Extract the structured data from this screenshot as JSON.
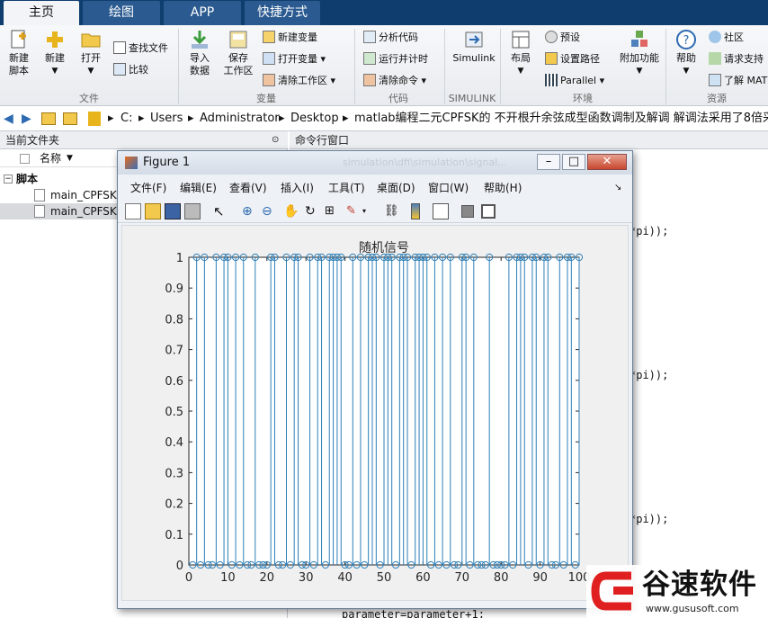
{
  "tabs": [
    "主页",
    "绘图",
    "APP",
    "快捷方式"
  ],
  "ribbon": {
    "buttons": {
      "new_script": "新建\n脚本",
      "new": "新建",
      "open": "打开",
      "find_files": "查找文件",
      "compare": "比较",
      "import_data": "导入\n数据",
      "save_workspace": "保存\n工作区",
      "new_variable": "新建变量",
      "open_variable": "打开变量",
      "clear_workspace": "清除工作区",
      "analyze_code": "分析代码",
      "run_time": "运行并计时",
      "clear_commands": "清除命令",
      "simulink": "Simulink",
      "layout": "布局",
      "preferences": "预设",
      "set_path": "设置路径",
      "parallel": "Parallel",
      "addons": "附加功能",
      "help": "帮助",
      "community": "社区",
      "request_support": "请求支持",
      "learn_matlab": "了解 MAT"
    },
    "sections": {
      "file": "文件",
      "variable": "变量",
      "code": "代码",
      "simulink": "SIMULINK",
      "environment": "环境",
      "resources": "资源"
    }
  },
  "address": [
    "C:",
    "Users",
    "Administrator",
    "Desktop",
    "matlab编程二元CPFSK的 不开根升余弦成型函数调制及解调 解调法采用了8倍采样的最"
  ],
  "left_panel": {
    "header": "当前文件夹",
    "col_name": "名称",
    "group": "脚本",
    "files": [
      "main_CPFSKM",
      "main_CPFSK2"
    ]
  },
  "command_window": {
    "header": "命令行窗口",
    "lines": [
      "*pi));",
      "*pi));",
      "*pi));",
      "parameter=parameter+1;"
    ]
  },
  "figure": {
    "title": "Figure 1",
    "faded_title": "simulation\\dfi\\simulation\\signal...",
    "menu": [
      "文件(F)",
      "编辑(E)",
      "查看(V)",
      "插入(I)",
      "工具(T)",
      "桌面(D)",
      "窗口(W)",
      "帮助(H)"
    ],
    "controls": [
      "minimize-icon",
      "maximize-icon",
      "close-icon"
    ]
  },
  "watermark": {
    "brand": "谷速软件",
    "url": "www.gususoft.com"
  },
  "chart_data": {
    "type": "stem",
    "title": "随机信号",
    "xlabel": "",
    "ylabel": "",
    "xlim": [
      0,
      100
    ],
    "ylim": [
      0,
      1
    ],
    "xticks": [
      0,
      10,
      20,
      30,
      40,
      50,
      60,
      70,
      80,
      90,
      100
    ],
    "yticks": [
      0,
      0.1,
      0.2,
      0.3,
      0.4,
      0.5,
      0.6,
      0.7,
      0.8,
      0.9,
      1
    ],
    "x": [
      1,
      2,
      3,
      4,
      5,
      6,
      7,
      8,
      9,
      10,
      11,
      12,
      13,
      14,
      15,
      16,
      17,
      18,
      19,
      20,
      21,
      22,
      23,
      24,
      25,
      26,
      27,
      28,
      29,
      30,
      31,
      32,
      33,
      34,
      35,
      36,
      37,
      38,
      39,
      40,
      41,
      42,
      43,
      44,
      45,
      46,
      47,
      48,
      49,
      50,
      51,
      52,
      53,
      54,
      55,
      56,
      57,
      58,
      59,
      60,
      61,
      62,
      63,
      64,
      65,
      66,
      67,
      68,
      69,
      70,
      71,
      72,
      73,
      74,
      75,
      76,
      77,
      78,
      79,
      80,
      81,
      82,
      83,
      84,
      85,
      86,
      87,
      88,
      89,
      90,
      91,
      92,
      93,
      94,
      95,
      96,
      97,
      98,
      99,
      100
    ],
    "y": [
      0,
      1,
      0,
      1,
      0,
      0,
      1,
      0,
      1,
      1,
      0,
      1,
      0,
      1,
      0,
      0,
      1,
      0,
      0,
      0,
      1,
      1,
      0,
      0,
      1,
      0,
      1,
      1,
      0,
      0,
      1,
      0,
      1,
      1,
      0,
      1,
      1,
      1,
      1,
      0,
      0,
      1,
      0,
      1,
      0,
      1,
      1,
      1,
      0,
      1,
      1,
      1,
      0,
      1,
      1,
      1,
      0,
      1,
      1,
      1,
      1,
      0,
      1,
      0,
      1,
      0,
      1,
      0,
      0,
      1,
      1,
      0,
      1,
      0,
      0,
      0,
      1,
      0,
      0,
      0,
      0,
      1,
      0,
      1,
      1,
      1,
      0,
      1,
      1,
      0,
      1,
      1,
      0,
      0,
      1,
      0,
      1,
      1,
      0,
      1
    ],
    "color": "#2d7fb8"
  }
}
